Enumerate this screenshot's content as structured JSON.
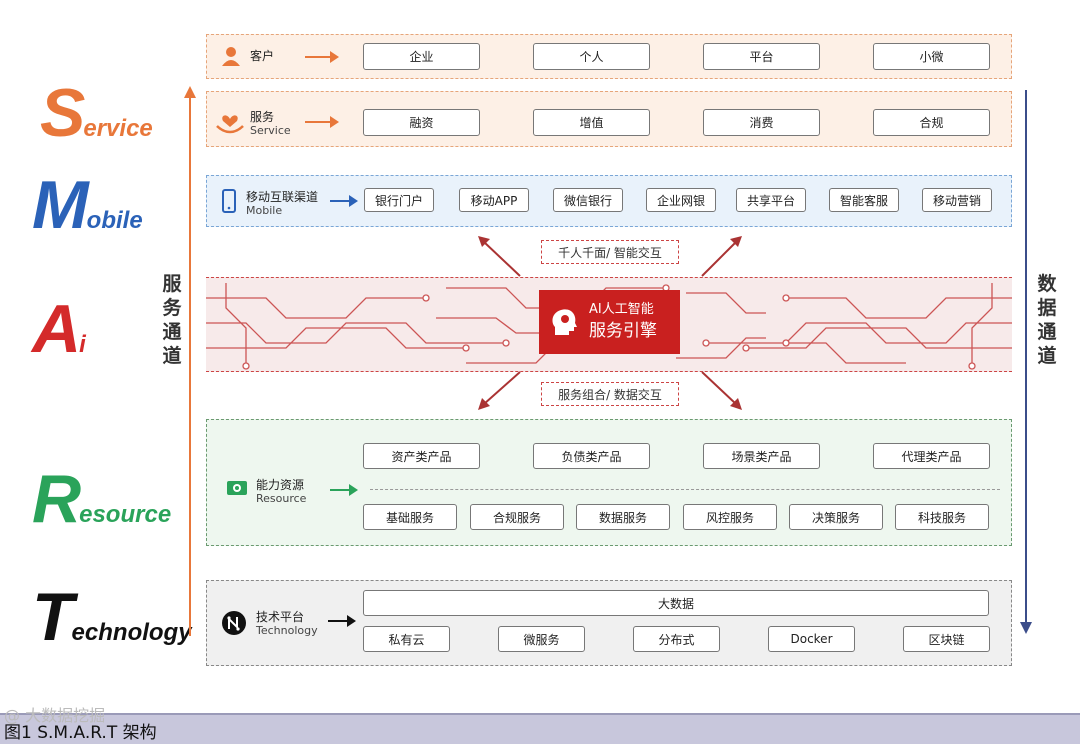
{
  "letters": {
    "service": {
      "cap": "S",
      "rest": "ervice"
    },
    "mobile": {
      "cap": "M",
      "rest": "obile"
    },
    "ai": {
      "cap": "A",
      "rest": "i"
    },
    "resource": {
      "cap": "R",
      "rest": "esource"
    },
    "technology": {
      "cap": "T",
      "rest": "echnology"
    }
  },
  "left_channel": "服务通道",
  "right_channel": "数据通道",
  "rows": {
    "customer": {
      "label": "客户",
      "items": [
        "企业",
        "个人",
        "平台",
        "小微"
      ]
    },
    "service": {
      "label": "服务",
      "label_en": "Service",
      "items": [
        "融资",
        "增值",
        "消费",
        "合规"
      ]
    },
    "mobile": {
      "label": "移动互联渠道",
      "label_en": "Mobile",
      "items": [
        "银行门户",
        "移动APP",
        "微信银行",
        "企业网银",
        "共享平台",
        "智能客服",
        "移动营销"
      ]
    },
    "resource": {
      "label": "能力资源",
      "label_en": "Resource",
      "products": [
        "资产类产品",
        "负债类产品",
        "场景类产品",
        "代理类产品"
      ],
      "services": [
        "基础服务",
        "合规服务",
        "数据服务",
        "风控服务",
        "决策服务",
        "科技服务"
      ]
    },
    "technology": {
      "label": "技术平台",
      "label_en": "Technology",
      "top": "大数据",
      "items": [
        "私有云",
        "微服务",
        "分布式",
        "Docker",
        "区块链"
      ]
    }
  },
  "ai": {
    "line1": "AI人工智能",
    "line2": "服务引擎",
    "top_tag": "千人千面/ 智能交互",
    "bottom_tag": "服务组合/ 数据交互"
  },
  "caption": "图1  S.M.A.R.T 架构",
  "watermark": "@ 大数据挖掘",
  "colors": {
    "service": "#e8773a",
    "mobile": "#2b62b8",
    "ai": "#d42a2a",
    "resource": "#2aa35a",
    "technology": "#111111"
  },
  "icons": {
    "customer": "person-icon",
    "service": "hands-heart-icon",
    "mobile": "phone-icon",
    "resource": "money-icon",
    "technology": "chip-logo-icon",
    "ai": "head-brain-icon"
  }
}
